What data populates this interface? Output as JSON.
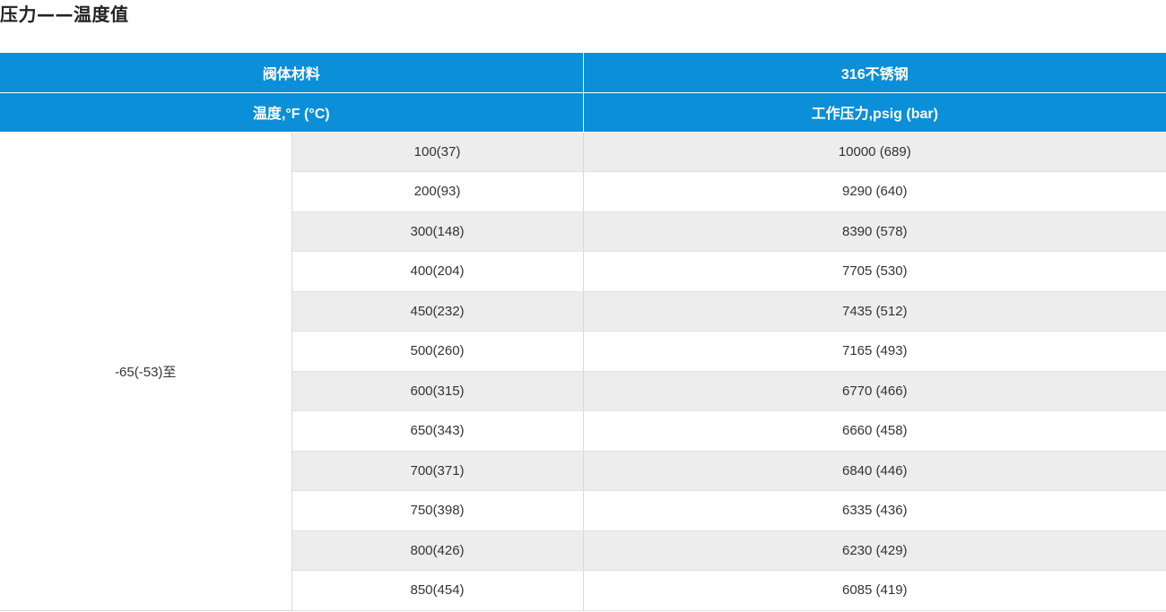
{
  "title": "压力——温度值",
  "table": {
    "header_material_label": "阀体材料",
    "header_material_value": "316不锈钢",
    "header_temp_label": "温度,°F (°C)",
    "header_pressure_label": "工作压力,psig (bar)",
    "range_label": "-65(-53)至",
    "rows": [
      {
        "temp": "100(37)",
        "pressure": "10000 (689)"
      },
      {
        "temp": "200(93)",
        "pressure": "9290 (640)"
      },
      {
        "temp": "300(148)",
        "pressure": "8390 (578)"
      },
      {
        "temp": "400(204)",
        "pressure": "7705 (530)"
      },
      {
        "temp": "450(232)",
        "pressure": "7435 (512)"
      },
      {
        "temp": "500(260)",
        "pressure": "7165 (493)"
      },
      {
        "temp": "600(315)",
        "pressure": "6770 (466)"
      },
      {
        "temp": "650(343)",
        "pressure": "6660 (458)"
      },
      {
        "temp": "700(371)",
        "pressure": "6840 (446)"
      },
      {
        "temp": "750(398)",
        "pressure": "6335 (436)"
      },
      {
        "temp": "800(426)",
        "pressure": "6230 (429)"
      },
      {
        "temp": "850(454)",
        "pressure": "6085 (419)"
      }
    ]
  }
}
